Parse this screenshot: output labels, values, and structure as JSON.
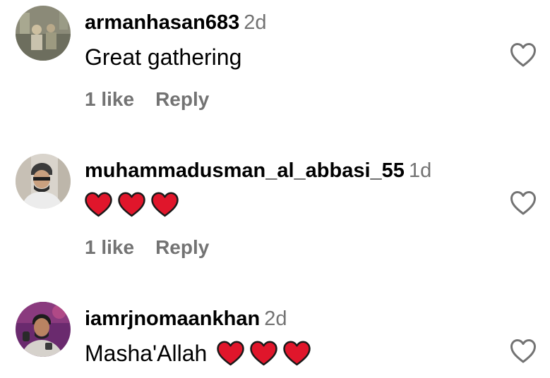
{
  "comments": [
    {
      "username": "armanhasan683",
      "time": "2d",
      "text": "Great gathering",
      "emoji": "",
      "likes": "1 like",
      "reply": "Reply"
    },
    {
      "username": "muhammadusman_al_abbasi_55",
      "time": "1d",
      "text": "",
      "emoji": "❤❤❤",
      "likes": "1 like",
      "reply": "Reply"
    },
    {
      "username": "iamrjnomaankhan",
      "time": "2d",
      "text": "Masha'Allah",
      "emoji": "❤❤❤",
      "likes": "",
      "reply": ""
    }
  ],
  "colors": {
    "heart_emoji": "#e0162b",
    "muted_text": "#737373",
    "icon_outline": "#737373"
  },
  "icons": {
    "like": "heart-outline-icon",
    "emoji": "red-heart-emoji-icon"
  }
}
